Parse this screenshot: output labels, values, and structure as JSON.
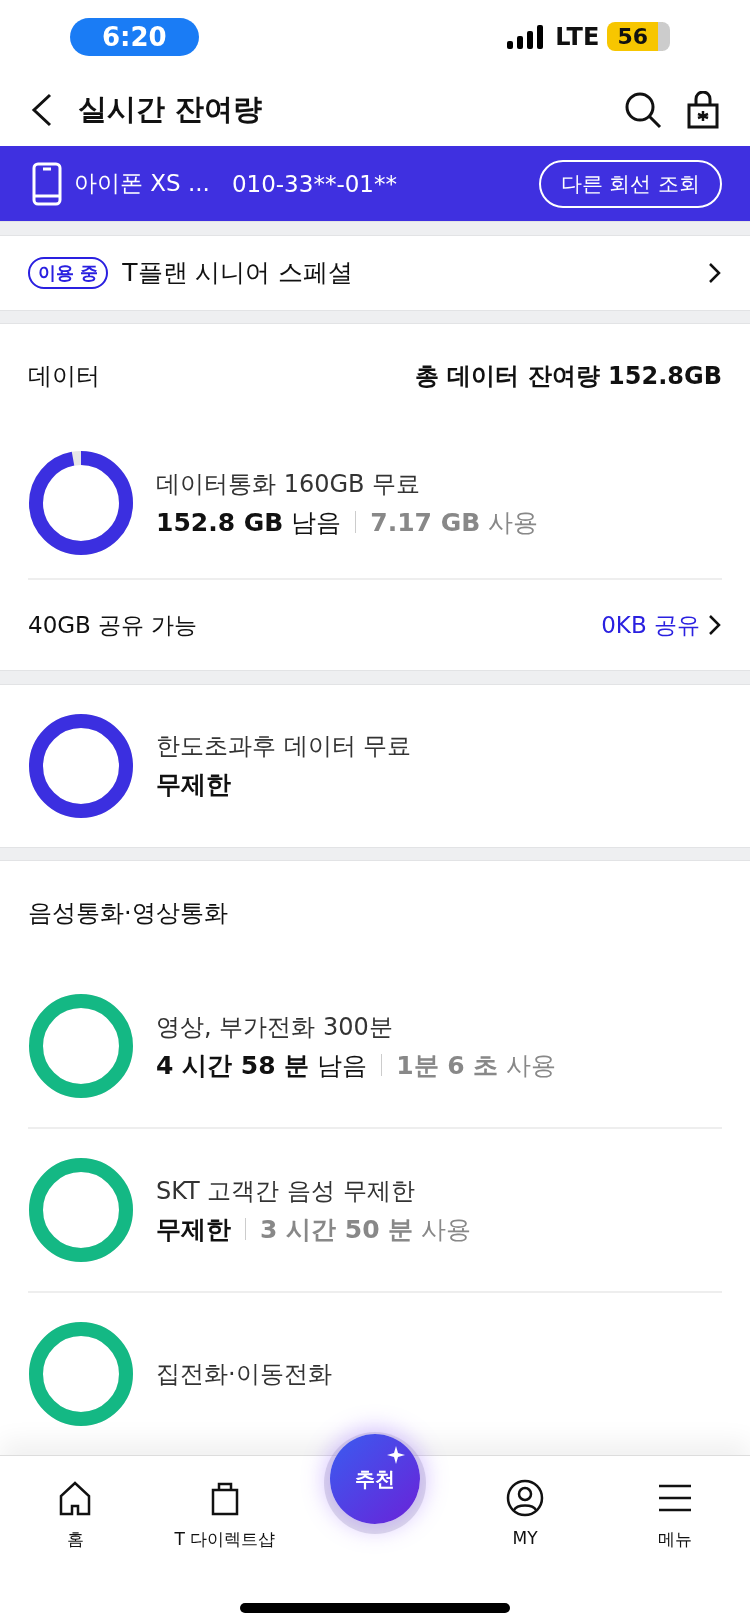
{
  "status_bar": {
    "time": "6:20",
    "network": "LTE",
    "battery": "56"
  },
  "header": {
    "title": "실시간 잔여량"
  },
  "line_bar": {
    "device": "아이폰 XS ...",
    "number": "010-33**-01**",
    "button": "다른 회선 조회"
  },
  "plan": {
    "badge": "이용 중",
    "name": "T플랜 시니어 스페셜"
  },
  "data_section": {
    "title": "데이터",
    "total": "총 데이터 잔여량 152.8GB",
    "items": [
      {
        "title": "데이터통화 160GB 무료",
        "remaining": "**152.8 GB** 남음",
        "used": "**7.17 GB** 사용",
        "color": "#3b2fe0"
      }
    ],
    "share": {
      "available": "40GB 공유 가능",
      "link": "0KB 공유"
    }
  },
  "extra_card": {
    "items": [
      {
        "title": "한도초과후 데이터 무료",
        "remaining": "**무제한**",
        "color": "#3b2fe0"
      }
    ]
  },
  "voice_section": {
    "title": "음성통화·영상통화",
    "items": [
      {
        "title": "영상, 부가전화 300분",
        "remaining": "**4 시간 58 분** 남음",
        "used": "**1분 6 초** 사용",
        "color": "#14b884"
      },
      {
        "title": "SKT 고객간 음성 무제한",
        "remaining": "**무제한**",
        "used": "**3 시간 50 분** 사용",
        "color": "#14b884"
      },
      {
        "title": "집전화·이동전화",
        "color": "#14b884"
      }
    ]
  },
  "bottom_nav": {
    "items": [
      {
        "label": "홈",
        "kind": "home"
      },
      {
        "label": "T 다이렉트샵",
        "kind": "bag"
      },
      {
        "label": "MY",
        "kind": "person"
      },
      {
        "label": "메뉴",
        "kind": "menu"
      }
    ],
    "center_button": "추천"
  }
}
